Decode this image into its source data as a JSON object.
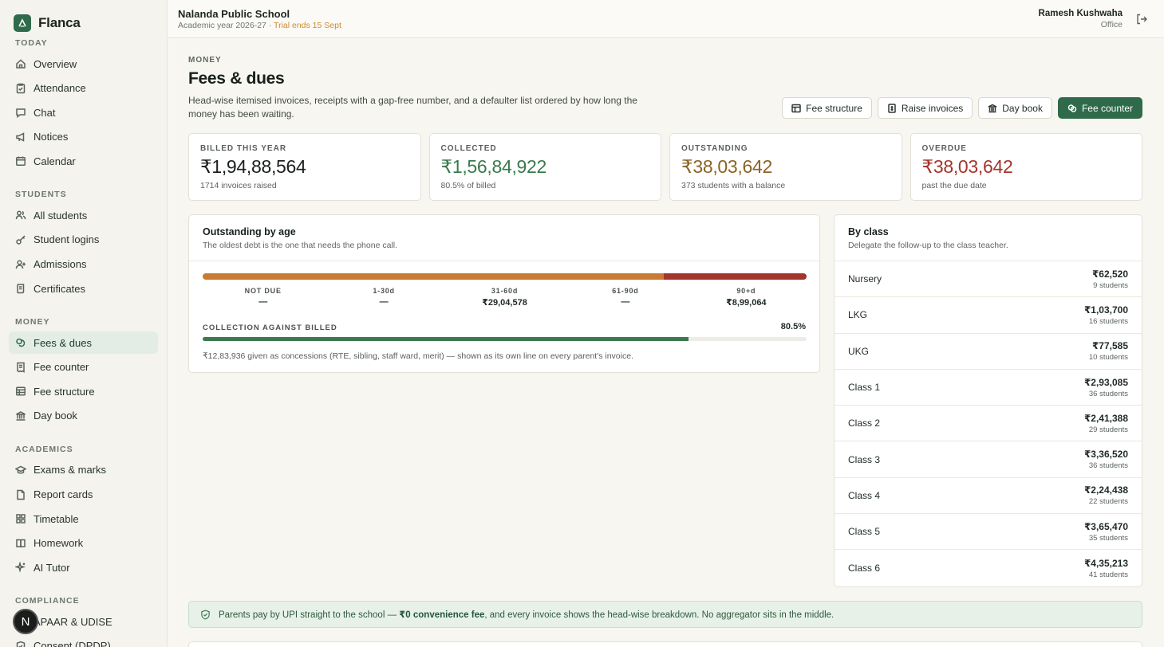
{
  "brand": {
    "name": "Flanca"
  },
  "header": {
    "school_name": "Nalanda Public School",
    "academic_year": "Academic year 2026-27 · ",
    "trial": "Trial ends 15 Sept",
    "user_name": "Ramesh Kushwaha",
    "user_role": "Office"
  },
  "sidebar": {
    "today_label": "TODAY",
    "today": [
      {
        "label": "Overview",
        "icon": "home-icon"
      },
      {
        "label": "Attendance",
        "icon": "clipboard-check-icon"
      },
      {
        "label": "Chat",
        "icon": "chat-icon"
      },
      {
        "label": "Notices",
        "icon": "megaphone-icon"
      },
      {
        "label": "Calendar",
        "icon": "calendar-icon"
      }
    ],
    "students_label": "STUDENTS",
    "students": [
      {
        "label": "All students",
        "icon": "users-icon"
      },
      {
        "label": "Student logins",
        "icon": "key-icon"
      },
      {
        "label": "Admissions",
        "icon": "user-plus-icon"
      },
      {
        "label": "Certificates",
        "icon": "scroll-icon"
      }
    ],
    "money_label": "MONEY",
    "money": [
      {
        "label": "Fees & dues",
        "icon": "coins-icon"
      },
      {
        "label": "Fee counter",
        "icon": "receipt-icon"
      },
      {
        "label": "Fee structure",
        "icon": "table-icon"
      },
      {
        "label": "Day book",
        "icon": "bank-icon"
      }
    ],
    "academics_label": "ACADEMICS",
    "academics": [
      {
        "label": "Exams & marks",
        "icon": "graduation-cap-icon"
      },
      {
        "label": "Report cards",
        "icon": "file-icon"
      },
      {
        "label": "Timetable",
        "icon": "grid-icon"
      },
      {
        "label": "Homework",
        "icon": "book-icon"
      },
      {
        "label": "AI Tutor",
        "icon": "sparkles-icon"
      }
    ],
    "compliance_label": "COMPLIANCE",
    "compliance": [
      {
        "label": "APAAR & UDISE",
        "icon": "id-card-icon"
      },
      {
        "label": "Consent (DPDP)",
        "icon": "shield-check-icon"
      }
    ],
    "avatar_letter": "N"
  },
  "page": {
    "eyebrow": "MONEY",
    "title": "Fees & dues",
    "description": "Head-wise itemised invoices, receipts with a gap-free number, and a defaulter list ordered by how long the money has been waiting."
  },
  "actions": {
    "fee_structure": "Fee structure",
    "raise_invoices": "Raise invoices",
    "day_book": "Day book",
    "fee_counter": "Fee counter"
  },
  "stats": [
    {
      "label": "BILLED THIS YEAR",
      "value": "₹1,94,88,564",
      "sub": "1714 invoices raised",
      "color": "#1b1f1c"
    },
    {
      "label": "COLLECTED",
      "value": "₹1,56,84,922",
      "sub": "80.5% of billed",
      "color": "#3a7a4d"
    },
    {
      "label": "OUTSTANDING",
      "value": "₹38,03,642",
      "sub": "373 students with a balance",
      "color": "#8a6424"
    },
    {
      "label": "OVERDUE",
      "value": "₹38,03,642",
      "sub": "past the due date",
      "color": "#a3352c"
    }
  ],
  "aging": {
    "title": "Outstanding by age",
    "subtitle": "The oldest debt is the one that needs the phone call.",
    "buckets": [
      {
        "label": "NOT DUE",
        "value": "—",
        "amount": 0,
        "color": "#3a7a4d"
      },
      {
        "label": "1-30d",
        "value": "—",
        "amount": 0,
        "color": "#d6a23a"
      },
      {
        "label": "31-60d",
        "value": "₹29,04,578",
        "amount": 2904578,
        "color": "#c97a33"
      },
      {
        "label": "61-90d",
        "value": "—",
        "amount": 0,
        "color": "#b65a2d"
      },
      {
        "label": "90+d",
        "value": "₹8,99,064",
        "amount": 899064,
        "color": "#a3352c"
      }
    ],
    "collection_label": "COLLECTION AGAINST BILLED",
    "collection_pct_text": "80.5%",
    "collection_pct": 80.5,
    "concession_note": "₹12,83,936 given as concessions (RTE, sibling, staff ward, merit) — shown as its own line on every parent's invoice."
  },
  "by_class": {
    "title": "By class",
    "subtitle": "Delegate the follow-up to the class teacher.",
    "rows": [
      {
        "name": "Nursery",
        "amount": "₹62,520",
        "count": "9 students"
      },
      {
        "name": "LKG",
        "amount": "₹1,03,700",
        "count": "16 students"
      },
      {
        "name": "UKG",
        "amount": "₹77,585",
        "count": "10 students"
      },
      {
        "name": "Class 1",
        "amount": "₹2,93,085",
        "count": "36 students"
      },
      {
        "name": "Class 2",
        "amount": "₹2,41,388",
        "count": "29 students"
      },
      {
        "name": "Class 3",
        "amount": "₹3,36,520",
        "count": "36 students"
      },
      {
        "name": "Class 4",
        "amount": "₹2,24,438",
        "count": "22 students"
      },
      {
        "name": "Class 5",
        "amount": "₹3,65,470",
        "count": "35 students"
      },
      {
        "name": "Class 6",
        "amount": "₹4,35,213",
        "count": "41 students"
      }
    ]
  },
  "upi_note": {
    "before": "Parents pay by UPI straight to the school — ",
    "bold": "₹0 convenience fee",
    "after": ", and every invoice shows the head-wise breakdown. No aggregator sits in the middle."
  }
}
